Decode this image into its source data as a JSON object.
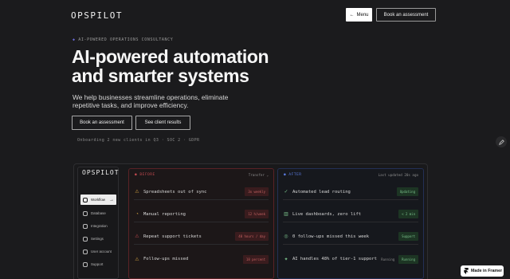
{
  "header": {
    "brand": "OPSPILOT",
    "menu_label": "Menu",
    "book_label": "Book an assessment"
  },
  "hero": {
    "eyebrow": "AI-POWERED OPERATIONS CONSULTANCY",
    "headline_line1": "AI-powered automation",
    "headline_line2": "and smarter systems",
    "sub_line1": "We help businesses streamline operations, eliminate",
    "sub_line2": "repetitive tasks, and improve efficiency.",
    "primary_cta": "Book an assessment",
    "secondary_cta": "See client results",
    "onboarding": "Onboarding 2 new clients in Q3 · SOC 2 · GDPR"
  },
  "dashboard": {
    "brand": "OPSPILOT",
    "sidebar": [
      {
        "label": "Workflow",
        "active": true
      },
      {
        "label": "Database",
        "active": false
      },
      {
        "label": "Integration",
        "active": false
      },
      {
        "label": "Settings",
        "active": false
      },
      {
        "label": "User account",
        "active": false
      },
      {
        "label": "Support",
        "active": false
      }
    ],
    "before": {
      "label": "BEFORE",
      "meta": "Transfer",
      "rows": [
        {
          "text": "Spreadsheets out of sync",
          "chip": "3x weekly"
        },
        {
          "text": "Manual reporting",
          "chip": "12 h/week"
        },
        {
          "text": "Repeat support tickets",
          "chip": "40 hours / day"
        },
        {
          "text": "Follow-ups missed",
          "chip": "18 percent"
        }
      ]
    },
    "after": {
      "label": "AFTER",
      "meta": "Last updated 20s ago",
      "rows": [
        {
          "text": "Automated lead routing",
          "extra": "",
          "chip": "Updating"
        },
        {
          "text": "Live dashboards, zero lift",
          "extra": "",
          "chip": "< 2 min"
        },
        {
          "text": "0 follow-ups missed this week",
          "extra": "",
          "chip": "Support"
        },
        {
          "text": "AI handles 48% of tier-1 support",
          "extra": "Running",
          "chip": "Running"
        }
      ]
    }
  },
  "badge": {
    "label": "Made in Framer"
  },
  "colors": {
    "background": "#1b1b1d",
    "before_accent": "#c0484e",
    "after_accent": "#5a7be0",
    "chip_green": "#79c08a"
  }
}
